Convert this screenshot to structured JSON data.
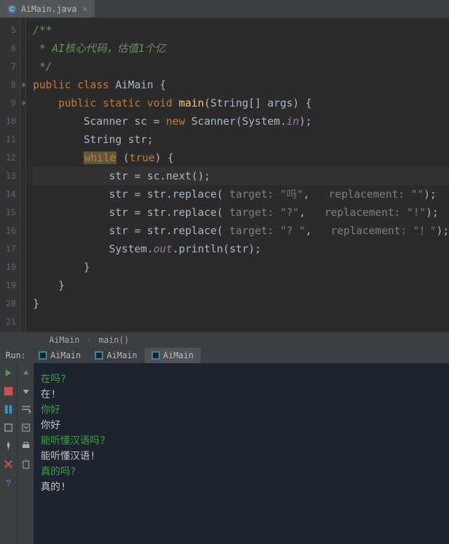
{
  "tab": {
    "filename": "AiMain.java"
  },
  "gutter": {
    "lines": [
      "5",
      "6",
      "7",
      "8",
      "9",
      "10",
      "11",
      "12",
      "13",
      "14",
      "15",
      "16",
      "17",
      "18",
      "19",
      "20",
      "21"
    ],
    "fold_markers_at": [
      8,
      9
    ]
  },
  "code": {
    "l5": "/**",
    "l6": " * AI核心代码，估值1个亿",
    "l7": " */",
    "l8_kw": "public class",
    "l8_name": " AiMain {",
    "l9_kw": "public static void",
    "l9_name": " main",
    "l9_rest": "(String[] args) {",
    "l10_a": "Scanner sc = ",
    "l10_new": "new",
    "l10_b": " Scanner(System.",
    "l10_in": "in",
    "l10_c": ");",
    "l11": "String str;",
    "l12_while": "while",
    "l12_rest": " (",
    "l12_true": "true",
    "l12_end": ") {",
    "l13": "str = sc.next();",
    "l14_a": "str = str.replace( ",
    "l14_p1": "target: ",
    "l14_s1": "\"吗\"",
    "l14_c1": ",   ",
    "l14_p2": "replacement: ",
    "l14_s2": "\"\"",
    "l14_end": ");",
    "l15_a": "str = str.replace( ",
    "l15_p1": "target: ",
    "l15_s1": "\"?\"",
    "l15_c1": ",   ",
    "l15_p2": "replacement: ",
    "l15_s2": "\"!\"",
    "l15_end": ");",
    "l16_a": "str = str.replace( ",
    "l16_p1": "target: ",
    "l16_s1": "\"? \"",
    "l16_c1": ",   ",
    "l16_p2": "replacement: ",
    "l16_s2": "\"！\"",
    "l16_end": ");",
    "l17_a": "System.",
    "l17_out": "out",
    "l17_b": ".println(str);",
    "l18": "}",
    "l19": "}",
    "l20": "}"
  },
  "breadcrumb": {
    "a": "AiMain",
    "b": "main()"
  },
  "run": {
    "label": "Run:",
    "tabs": [
      "AiMain",
      "AiMain",
      "AiMain"
    ],
    "active": 2
  },
  "console_lines": [
    {
      "kind": "inp",
      "text": "在吗?"
    },
    {
      "kind": "outp",
      "text": "在!"
    },
    {
      "kind": "inp",
      "text": "你好"
    },
    {
      "kind": "outp",
      "text": "你好"
    },
    {
      "kind": "inp",
      "text": "能听懂汉语吗?"
    },
    {
      "kind": "outp",
      "text": "能听懂汉语!"
    },
    {
      "kind": "inp",
      "text": "真的吗?"
    },
    {
      "kind": "outp",
      "text": "真的!"
    }
  ]
}
